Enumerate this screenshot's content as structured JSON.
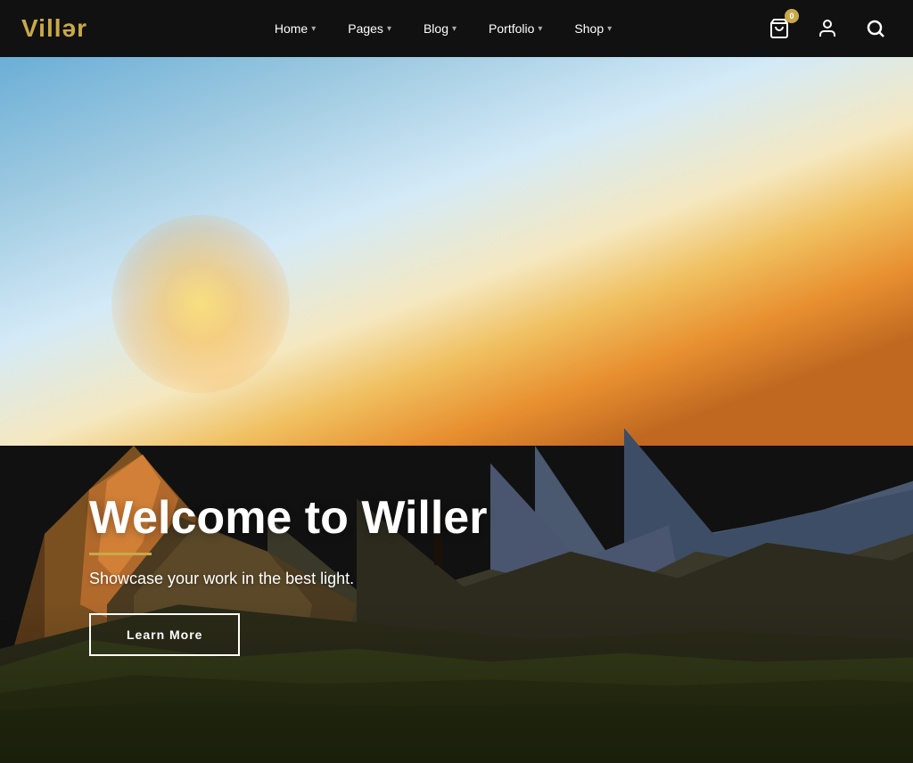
{
  "brand": {
    "name_prefix": "Vill",
    "name_accent": "ə",
    "name_suffix": "r"
  },
  "navbar": {
    "links": [
      {
        "id": "home",
        "label": "Home",
        "hasDropdown": true
      },
      {
        "id": "pages",
        "label": "Pages",
        "hasDropdown": true
      },
      {
        "id": "blog",
        "label": "Blog",
        "hasDropdown": true
      },
      {
        "id": "portfolio",
        "label": "Portfolio",
        "hasDropdown": true
      },
      {
        "id": "shop",
        "label": "Shop",
        "hasDropdown": true
      }
    ],
    "cart_count": "0",
    "icons": {
      "cart": "cart-icon",
      "user": "user-icon",
      "search": "search-icon"
    }
  },
  "hero": {
    "title": "Welcome to Willer",
    "subtitle": "Showcase your work in the best light.",
    "cta_label": "Learn More"
  },
  "colors": {
    "accent": "#c8a94a",
    "nav_bg": "#111111",
    "text_white": "#ffffff"
  }
}
